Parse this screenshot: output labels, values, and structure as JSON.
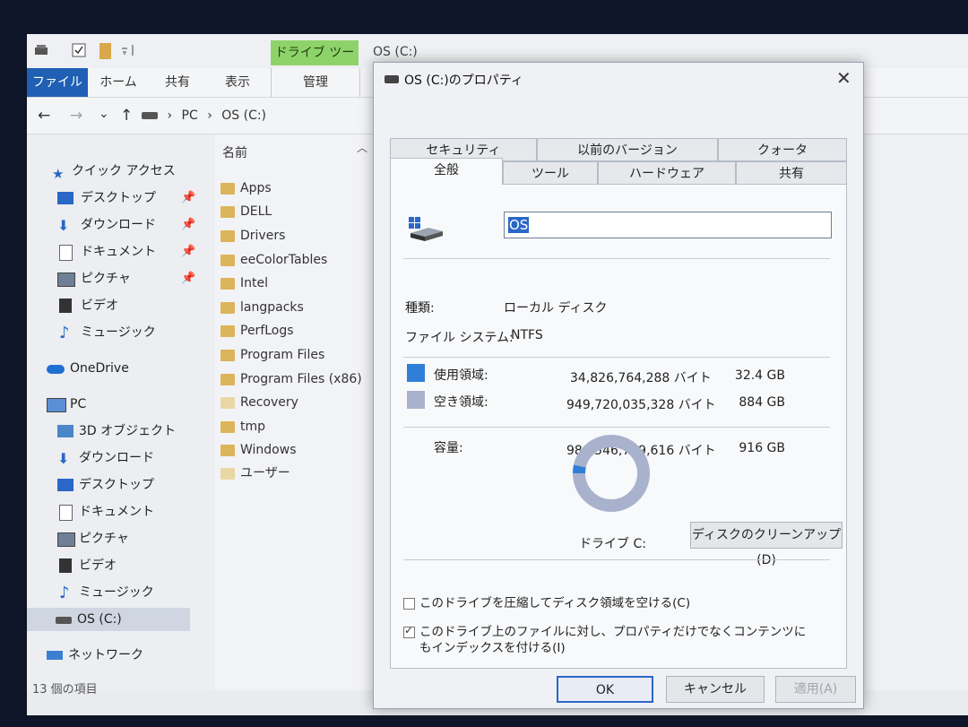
{
  "quick_access_toolbar": {
    "items": [
      "save-icon",
      "properties-icon",
      "new-folder-icon",
      "customize-icon"
    ]
  },
  "ribbon": {
    "context_tab": "ドライブ ツール",
    "window_title": "OS (C:)",
    "tabs": [
      "ファイル",
      "ホーム",
      "共有",
      "表示",
      "管理"
    ]
  },
  "address_bar": {
    "back": "←",
    "forward": "→",
    "recent": "⌄",
    "up": "↑",
    "path": [
      "PC",
      "OS (C:)"
    ]
  },
  "nav_pane": {
    "quick_access": "クイック アクセス",
    "quick_items": [
      "デスクトップ",
      "ダウンロード",
      "ドキュメント",
      "ピクチャ",
      "ビデオ",
      "ミュージック"
    ],
    "onedrive": "OneDrive",
    "pc": "PC",
    "pc_items": [
      "3D オブジェクト",
      "ダウンロード",
      "デスクトップ",
      "ドキュメント",
      "ピクチャ",
      "ビデオ",
      "ミュージック",
      "OS (C:)"
    ],
    "network": "ネットワーク"
  },
  "file_list": {
    "column_name": "名前",
    "items": [
      "Apps",
      "DELL",
      "Drivers",
      "eeColorTables",
      "Intel",
      "langpacks",
      "PerfLogs",
      "Program Files",
      "Program Files (x86)",
      "Recovery",
      "tmp",
      "Windows",
      "ユーザー"
    ]
  },
  "status_bar": {
    "count": "13 個の項目"
  },
  "dialog": {
    "title": "OS (C:)のプロパティ",
    "close": "✕",
    "tabs_back": [
      "セキュリティ",
      "以前のバージョン",
      "クォータ"
    ],
    "tabs_front": [
      "全般",
      "ツール",
      "ハードウェア",
      "共有"
    ],
    "active_tab": "全般",
    "drive_name": "OS",
    "type_label": "種類:",
    "type_value": "ローカル ディスク",
    "fs_label": "ファイル システム:",
    "fs_value": "NTFS",
    "used_label": "使用領域:",
    "used_bytes": "34,826,764,288 バイト",
    "used_size": "32.4 GB",
    "free_label": "空き領域:",
    "free_bytes": "949,720,035,328 バイト",
    "free_size": "884 GB",
    "capacity_label": "容量:",
    "capacity_bytes": "984,546,799,616 バイト",
    "capacity_size": "916 GB",
    "drive_label": "ドライブ C:",
    "cleanup_button": "ディスクのクリーンアップ(D)",
    "compress_label": "このドライブを圧縮してディスク領域を空ける(C)",
    "compress_checked": false,
    "index_label": "このドライブ上のファイルに対し、プロパティだけでなくコンテンツにもインデックスを付ける(I)",
    "index_checked": true,
    "ok_button": "OK",
    "cancel_button": "キャンセル",
    "apply_button": "適用(A)",
    "used_fraction": 0.0354,
    "colors": {
      "used": "#2f7fd8",
      "free": "#a9b2cc",
      "accent": "#2a67c7"
    }
  }
}
